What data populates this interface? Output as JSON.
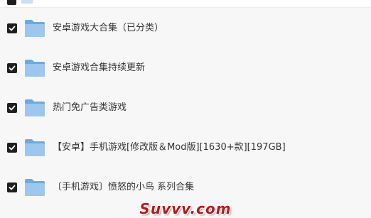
{
  "items": [
    {
      "label": "安卓游戏大合集（已分类）",
      "checked": true,
      "icon": "folder-icon"
    },
    {
      "label": "安卓游戏合集持续更新",
      "checked": true,
      "icon": "folder-icon"
    },
    {
      "label": "热门免广告类游戏",
      "checked": true,
      "icon": "folder-icon"
    },
    {
      "label": "【安卓】手机游戏[修改版＆Mod版][1630+款][197GB]",
      "checked": true,
      "icon": "folder-icon"
    },
    {
      "label": "〔手机游戏〕愤怒的小鸟 系列合集",
      "checked": true,
      "icon": "folder-icon"
    }
  ],
  "watermark": "Suvvv.com",
  "colors": {
    "folder_front": "#9dc7ee",
    "folder_back": "#6fa9e0",
    "checkbox": "#1f1f1f",
    "watermark": "#b61b1b"
  }
}
